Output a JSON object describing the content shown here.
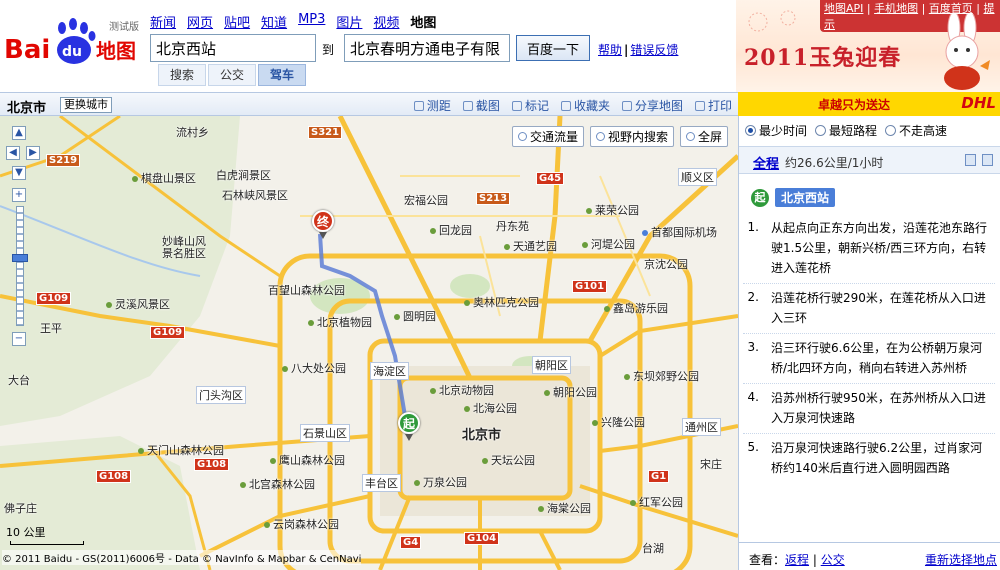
{
  "header": {
    "logo_text": "Bai",
    "logo_du": "du",
    "logo_map": "地图",
    "logo_beta": "测试版",
    "nav": [
      "新闻",
      "网页",
      "贴吧",
      "知道",
      "MP3",
      "图片",
      "视频",
      "地图"
    ],
    "from_value": "北京西站",
    "to_label": "到",
    "to_value": "北京春明方通电子有限",
    "search_label": "百度一下",
    "help": "帮助",
    "feedback": "错误反馈",
    "modes": [
      "搜索",
      "公交",
      "驾车"
    ]
  },
  "banner": {
    "links": [
      "地图API",
      "手机地图",
      "百度首页",
      "提示"
    ],
    "title": "2011玉兔迎春"
  },
  "toolbar": {
    "city": "北京市",
    "change_city": "更换城市",
    "tools": [
      "测距",
      "截图",
      "标记",
      "收藏夹",
      "分享地图",
      "打印"
    ]
  },
  "promo": {
    "text": "卓越只为送达",
    "logo": "DHL"
  },
  "map": {
    "buttons": [
      "交通流量",
      "视野内搜索",
      "全屏"
    ],
    "scale": "10 公里",
    "copyright": "© 2011 Baidu - GS(2011)6006号 - Data © NavInfo & Mapbar & CenNavi",
    "end_marker": "终",
    "start_marker": "起",
    "places": {
      "p1": "流村乡",
      "p2": "棋盘山景区",
      "p3": "白虎涧景区",
      "p4": "石林峡风景区",
      "p5": "妙峰山风景名胜区",
      "p6": "灵溪风景区",
      "p7": "王平",
      "p8": "大台",
      "p9": "门头沟区",
      "p10": "天门山森林公园",
      "p11": "佛子庄",
      "p12": "宏福公园",
      "p13": "回龙园",
      "p14": "丹东苑",
      "p15": "天通艺园",
      "p16": "莱荣公园",
      "p17": "河堤公园",
      "p18": "首都国际机场",
      "p19": "顺义区",
      "p20": "百望山森林公园",
      "p21": "北京植物园",
      "p22": "奥林匹克公园",
      "p23": "圆明园",
      "p24": "鑫岛游乐园",
      "p25": "八大处公园",
      "p26": "海淀区",
      "p27": "朝阳区",
      "p28": "北京动物园",
      "p29": "朝阳公园",
      "p30": "北海公园",
      "p31": "东坝郊野公园",
      "p32": "石景山区",
      "p33": "北京市",
      "p34": "兴隆公园",
      "p35": "通州区",
      "p36": "天坛公园",
      "p37": "丰台区",
      "p38": "万泉公园",
      "p39": "北宫森林公园",
      "p40": "鹰山森林公园",
      "p41": "云岗森林公园",
      "p42": "海棠公园",
      "p43": "红军公园",
      "p44": "台湖",
      "p45": "京沈公园",
      "p46": "宋庄"
    },
    "shields": [
      "S321",
      "S219",
      "G109",
      "G109",
      "G108",
      "G108",
      "G45",
      "S213",
      "G101",
      "G1",
      "G104",
      "G4"
    ]
  },
  "panel": {
    "options": [
      "最少时间",
      "最短路程",
      "不走高速"
    ],
    "summary_title": "全程",
    "summary_info": "约26.6公里/1小时",
    "start_icon": "起",
    "start_name": "北京西站",
    "steps": [
      "从起点向正东方向出发，沿莲花池东路行驶1.5公里，朝新兴桥/西三环方向，右转进入莲花桥",
      "沿莲花桥行驶290米，在莲花桥从入口进入三环",
      "沿三环行驶6.6公里，在为公桥朝万泉河桥/北四环方向，稍向右转进入苏州桥",
      "沿苏州桥行驶950米，在苏州桥从入口进入万泉河快速路",
      "沿万泉河快速路行驶6.2公里，过肖家河桥约140米后直行进入圆明园西路"
    ],
    "footer_label": "查看：",
    "footer_links": [
      "返程",
      "公交"
    ],
    "footer_right": "重新选择地点"
  }
}
